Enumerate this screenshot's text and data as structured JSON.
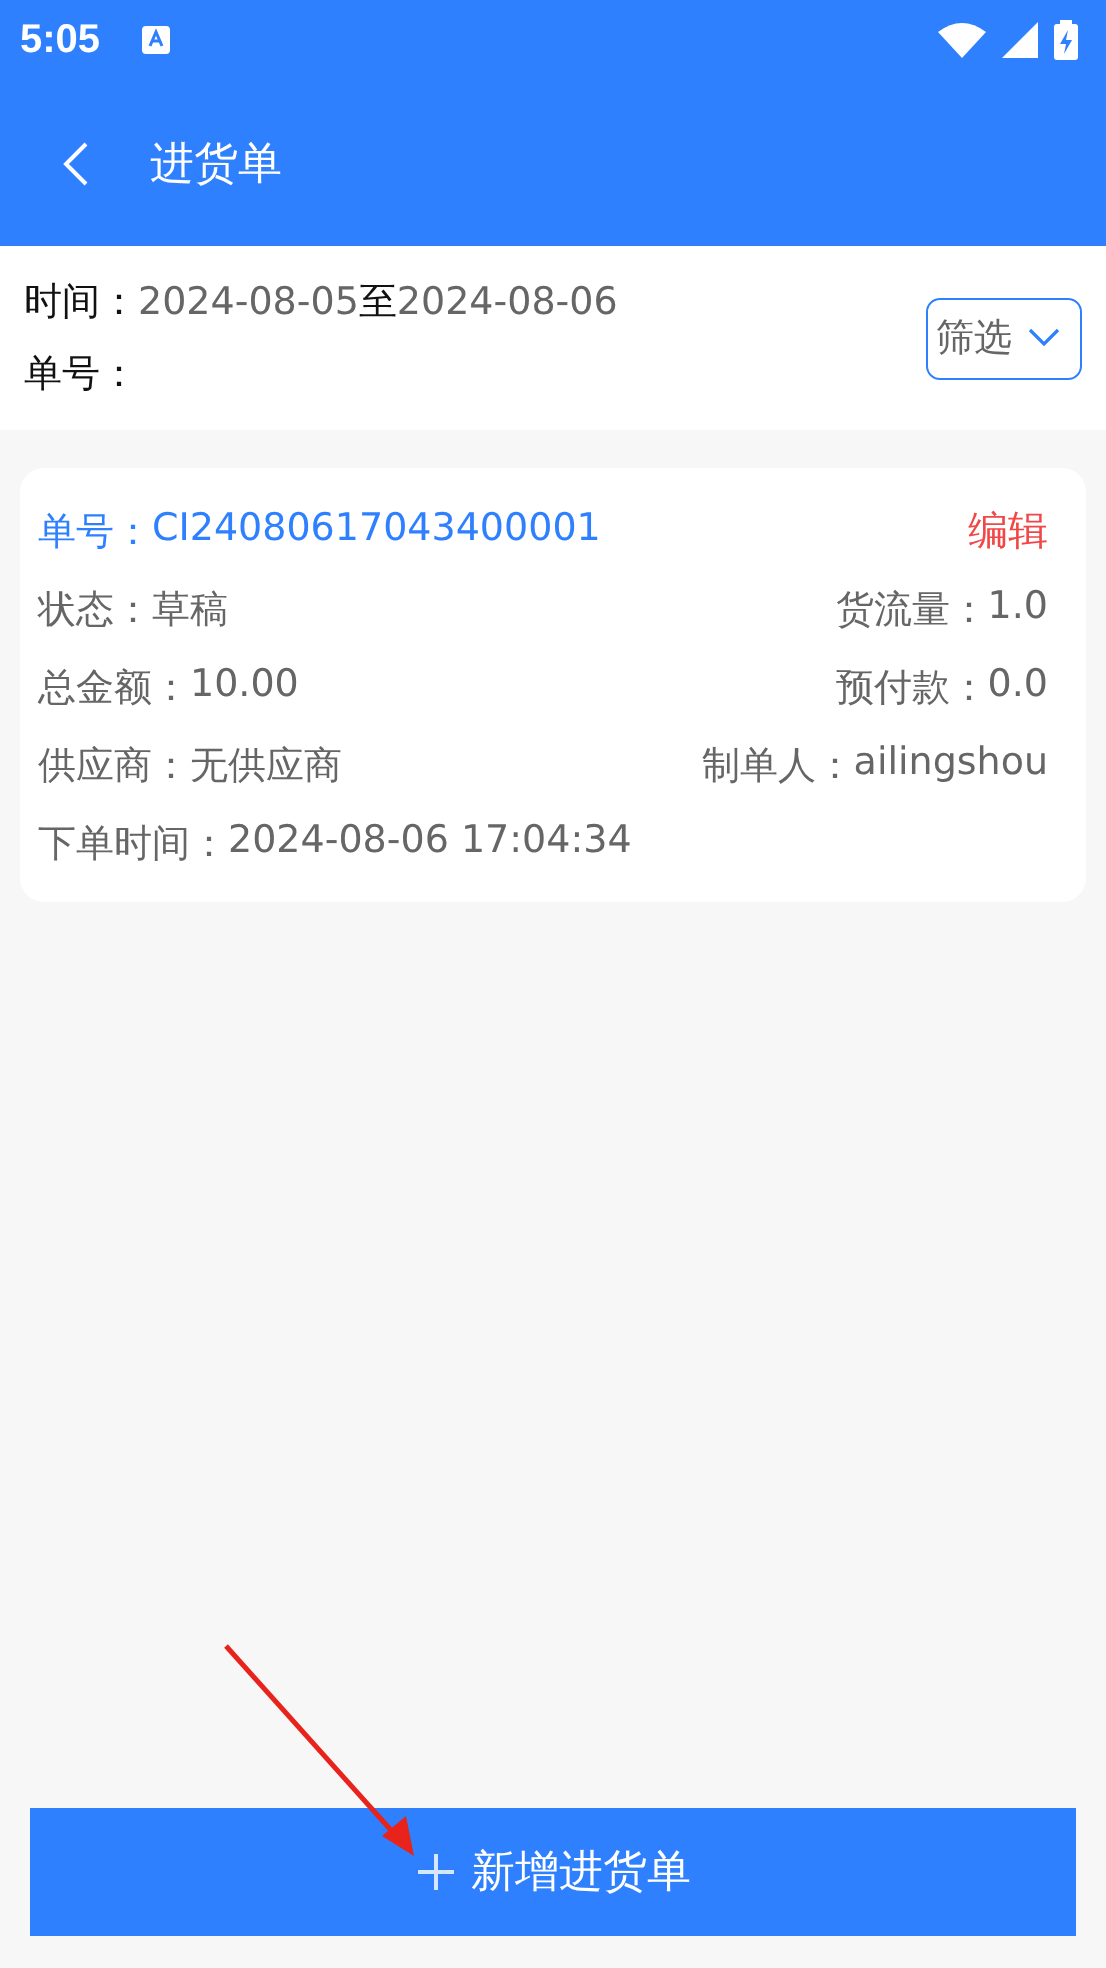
{
  "status_bar": {
    "time": "5:05"
  },
  "app_bar": {
    "title": "进货单"
  },
  "filter": {
    "time_label": "时间：",
    "date_from": "2024-08-05",
    "date_sep": "至",
    "date_to": "2024-08-06",
    "order_label": "单号：",
    "button": "筛选"
  },
  "orders": [
    {
      "order_no_label": "单号：",
      "order_no": "CI24080617043400001",
      "edit": "编辑",
      "rows": [
        [
          {
            "label": "状态：",
            "value": "草稿"
          },
          {
            "label": "货流量：",
            "value": "1.0"
          }
        ],
        [
          {
            "label": "总金额：",
            "value": "10.00"
          },
          {
            "label": "预付款：",
            "value": "0.0"
          }
        ],
        [
          {
            "label": "供应商：",
            "value": "无供应商"
          },
          {
            "label": "制单人：",
            "value": "ailingshou"
          }
        ],
        [
          {
            "label": "下单时间：",
            "value": "2024-08-06 17:04:34"
          }
        ]
      ]
    }
  ],
  "add_button": {
    "label": "新增进货单"
  }
}
